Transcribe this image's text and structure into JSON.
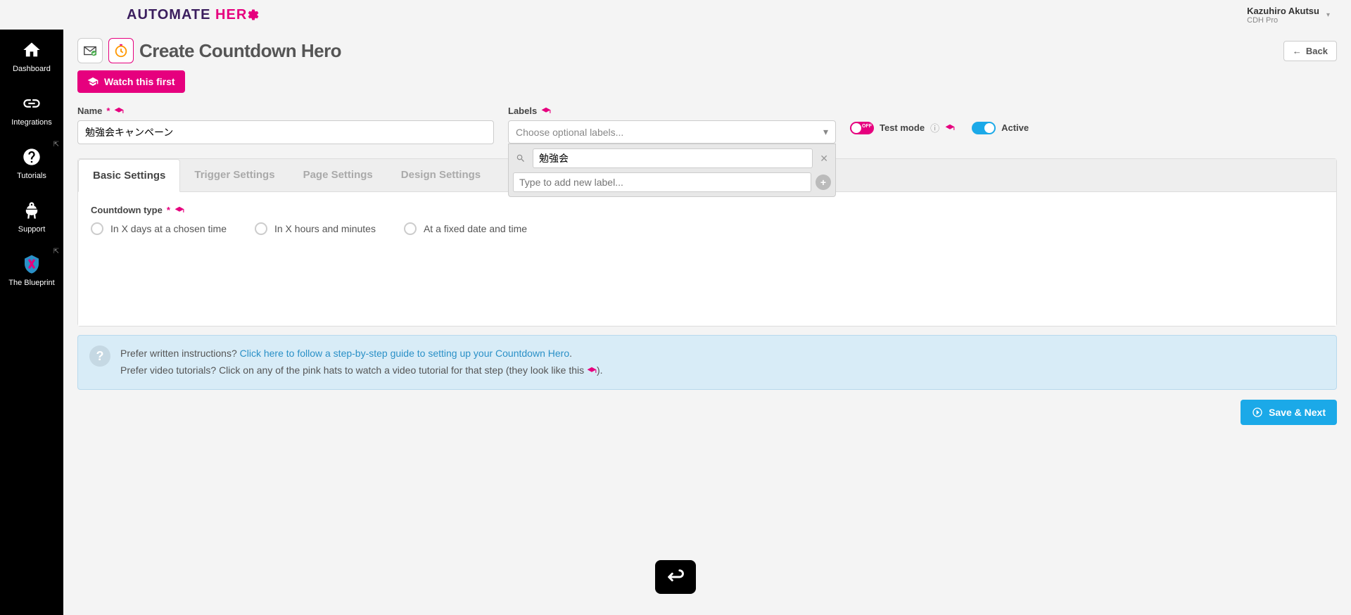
{
  "header": {
    "logo_part1": "AUTOMATE",
    "logo_part2": "HER",
    "user_name": "Kazuhiro Akutsu",
    "user_plan": "CDH Pro"
  },
  "sidebar": {
    "items": [
      {
        "label": "Dashboard"
      },
      {
        "label": "Integrations"
      },
      {
        "label": "Tutorials"
      },
      {
        "label": "Support"
      },
      {
        "label": "The Blueprint"
      }
    ]
  },
  "page": {
    "title": "Create Countdown Hero",
    "back_label": "Back",
    "watch_label": "Watch this first"
  },
  "form": {
    "name_label": "Name",
    "name_value": "勉強会キャンペーン",
    "labels_label": "Labels",
    "labels_placeholder": "Choose optional labels...",
    "search_value": "勉強会",
    "add_label_placeholder": "Type to add new label...",
    "test_mode_label": "Test mode",
    "active_label": "Active"
  },
  "tabs": {
    "items": [
      {
        "label": "Basic Settings"
      },
      {
        "label": "Trigger Settings"
      },
      {
        "label": "Page Settings"
      },
      {
        "label": "Design Settings"
      }
    ]
  },
  "countdown": {
    "label": "Countdown type",
    "options": [
      "In X days at a chosen time",
      "In X hours and minutes",
      "At a fixed date and time"
    ]
  },
  "info": {
    "line1_prefix": "Prefer written instructions? ",
    "line1_link": "Click here to follow a step-by-step guide to setting up your Countdown Hero",
    "line1_suffix": ".",
    "line2_prefix": "Prefer video tutorials? Click on any of the pink hats to watch a video tutorial for that step (they look like this ",
    "line2_suffix": ")."
  },
  "actions": {
    "save_label": "Save & Next"
  }
}
